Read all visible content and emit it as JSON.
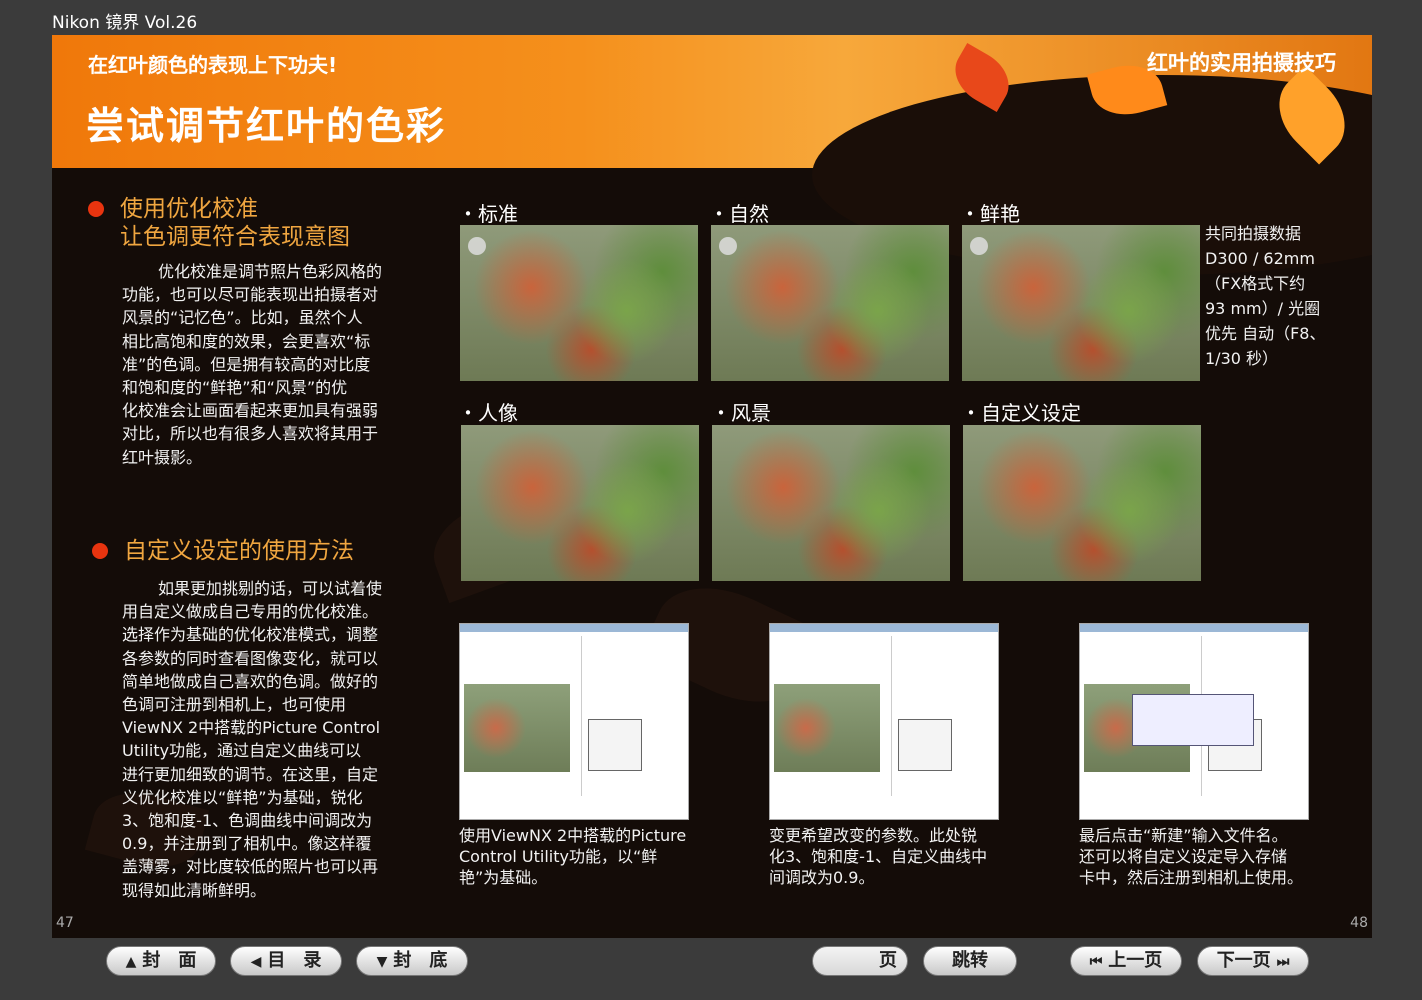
{
  "app_title": "Nikon 镜界 Vol.26",
  "header": {
    "subtitle": "在红叶颜色的表现上下功夫!",
    "title": "尝试调节红叶的色彩",
    "section_tag": "红叶的实用拍摄技巧"
  },
  "section1": {
    "heading_line1": "使用优化校准",
    "heading_line2": "让色调更符合表现意图",
    "body": [
      "优化校准是调节照片色彩风格的",
      "功能，也可以尽可能表现出拍摄者对",
      "风景的“记忆色”。比如，虽然个人",
      "相比高饱和度的效果，会更喜欢“标",
      "准”的色调。但是拥有较高的对比度",
      "和饱和度的“鲜艳”和“风景”的优",
      "化校准会让画面看起来更加具有强弱",
      "对比，所以也有很多人喜欢将其用于",
      "红叶摄影。"
    ]
  },
  "section2": {
    "heading": "自定义设定的使用方法",
    "body": [
      "如果更加挑剔的话，可以试着使",
      "用自定义做成自己专用的优化校准。",
      "选择作为基础的优化校准模式，调整",
      "各参数的同时查看图像变化，就可以",
      "简单地做成自己喜欢的色调。做好的",
      "色调可注册到相机上，也可使用",
      "ViewNX 2中搭载的Picture Control",
      "Utility功能，通过自定义曲线可以",
      "进行更加细致的调节。在这里，自定",
      "义优化校准以“鲜艳”为基础，锐化",
      "3、饱和度-1、色调曲线中间调改为",
      "0.9，并注册到了相机中。像这样覆",
      "盖薄雾，对比度较低的照片也可以再",
      "现得如此清晰鲜明。"
    ]
  },
  "photos": [
    {
      "label": "・标准"
    },
    {
      "label": "・自然"
    },
    {
      "label": "・鲜艳"
    },
    {
      "label": "・人像"
    },
    {
      "label": "・风景"
    },
    {
      "label": "・自定义设定"
    }
  ],
  "shooting_data": [
    "共同拍摄数据",
    "D300 / 62mm",
    "（FX格式下约",
    "93 mm）/ 光圈",
    "优先 自动（F8、",
    "1/30 秒）"
  ],
  "screens": [
    {
      "caption": [
        "使用ViewNX 2中搭载的Picture",
        "Control Utility功能，以“鲜",
        "艳”为基础。"
      ]
    },
    {
      "caption": [
        "变更希望改变的参数。此处锐",
        "化3、饱和度-1、自定义曲线中",
        "间调改为0.9。"
      ]
    },
    {
      "caption": [
        "最后点击“新建”输入文件名。",
        "还可以将自定义设定导入存储",
        "卡中，然后注册到相机上使用。"
      ]
    }
  ],
  "page_numbers": {
    "left": "47",
    "right": "48"
  },
  "nav": {
    "cover": "封　面",
    "toc": "目　录",
    "back_cover": "封　底",
    "page_suffix": "页",
    "page_value": "",
    "jump": "跳转",
    "prev": "上一页",
    "next": "下一页"
  }
}
